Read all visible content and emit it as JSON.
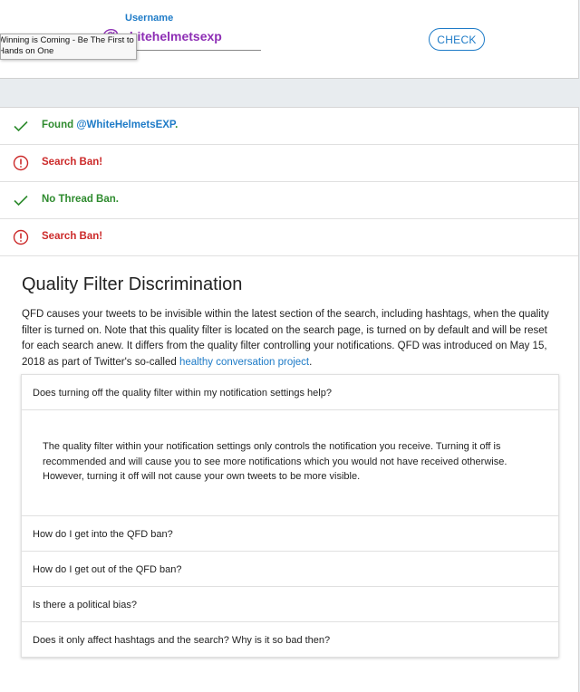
{
  "header": {
    "username_label": "Username",
    "username_prefix": "@",
    "username_value": "whitehelmetsexp",
    "check_button": "CHECK",
    "tooltip_line1": "Winning is Coming - Be The First to Get",
    "tooltip_line2": "Hands on One"
  },
  "results": [
    {
      "status": "ok",
      "icon": "check-icon",
      "text": "Found ",
      "handle": "@WhiteHelmetsEXP",
      "suffix": "."
    },
    {
      "status": "bad",
      "icon": "alert-circle-icon",
      "text": "Search Ban!"
    },
    {
      "status": "ok",
      "icon": "check-icon",
      "text": "No Thread Ban."
    },
    {
      "status": "bad",
      "icon": "alert-circle-icon",
      "text": "Search Ban!"
    }
  ],
  "qfd": {
    "title": "Quality Filter Discrimination",
    "description": "QFD causes your tweets to be invisible within the latest section of the search, including hashtags, when the quality filter is turned on. Note that this quality filter is located on the search page, is turned on by default and will be reset for each search anew. It differs from the quality filter controlling your notifications. QFD was introduced on May 15, 2018 as part of Twitter's so-called ",
    "link_text": "healthy conversation project",
    "description_end": "."
  },
  "faq": {
    "q1": "Does turning off the quality filter within my notification settings help?",
    "a1": "The quality filter within your notification settings only controls the notification you receive. Turning it off is recommended and will cause you to see more notifications which you would not have received otherwise. However, turning it off will not cause your own tweets to be more visible.",
    "q2": "How do I get into the QFD ban?",
    "q3": "How do I get out of the QFD ban?",
    "q4": "Is there a political bias?",
    "q5": "Does it only affect hashtags and the search? Why is it so bad then?"
  },
  "colors": {
    "accent": "#1e7bc7",
    "ok": "#2e8b2e",
    "bad": "#cc2a2a",
    "username": "#8e2fb5"
  }
}
